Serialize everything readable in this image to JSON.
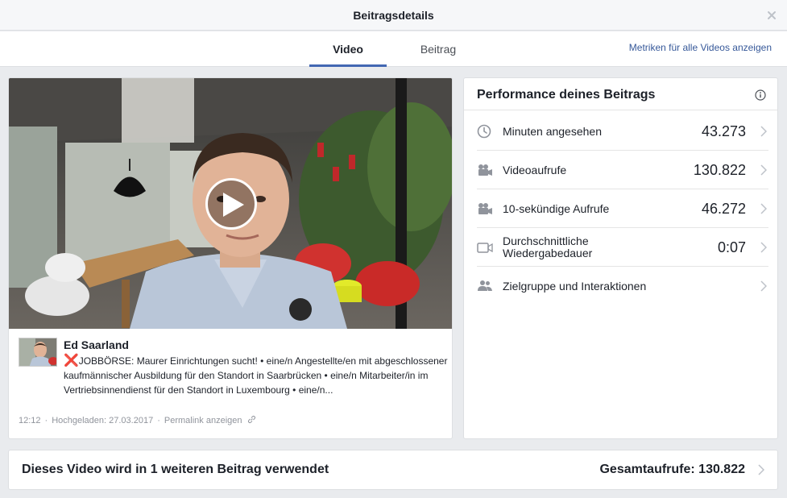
{
  "dialog": {
    "title": "Beitragsdetails"
  },
  "tabs": [
    {
      "label": "Video",
      "active": true
    },
    {
      "label": "Beitrag",
      "active": false
    }
  ],
  "metrics_link": "Metriken für alle Videos anzeigen",
  "post": {
    "page_name": "Ed Saarland",
    "emoji": "❌",
    "text": "JOBBÖRSE: Maurer Einrichtungen sucht! • eine/n Angestellte/en mit abgeschlossener kaufmännischer Ausbildung für den Standort in Saarbrücken • eine/n Mitarbeiter/in im Vertriebsinnendienst für den Standort in Luxembourg • eine/n...",
    "duration": "12:12",
    "uploaded": "Hochgeladen: 27.03.2017",
    "permalink": "Permalink anzeigen"
  },
  "performance": {
    "title": "Performance deines Beitrags",
    "rows": [
      {
        "icon": "clock-icon",
        "label": "Minuten angesehen",
        "value": "43.273"
      },
      {
        "icon": "video-camera-icon",
        "label": "Videoaufrufe",
        "value": "130.822"
      },
      {
        "icon": "video-camera-icon",
        "label": "10-sekündige Aufrufe",
        "value": "46.272"
      },
      {
        "icon": "video-duration-icon",
        "label": "Durchschnittliche Wiedergabedauer",
        "value": "0:07"
      },
      {
        "icon": "people-icon",
        "label": "Zielgruppe und Interaktionen",
        "value": ""
      }
    ]
  },
  "bottom": {
    "reuse_text": "Dieses Video wird in 1 weiteren Beitrag verwendet",
    "total_views": "Gesamtaufrufe: 130.822"
  },
  "colors": {
    "accent": "#4267b2",
    "link": "#365899",
    "background": "#e9ebee"
  }
}
